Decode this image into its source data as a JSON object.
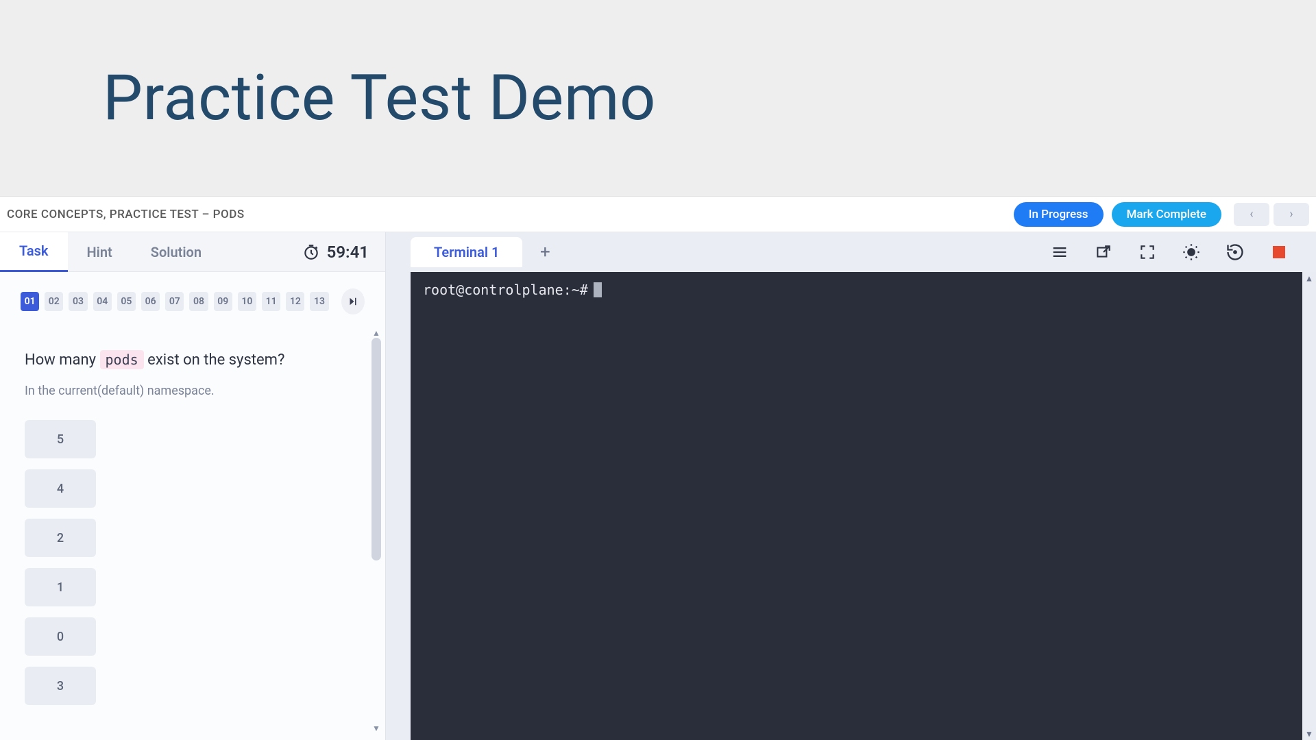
{
  "header": {
    "title": "Practice Test Demo"
  },
  "breadcrumb": "CORE CONCEPTS, PRACTICE TEST – PODS",
  "status": {
    "in_progress": "In Progress",
    "mark_complete": "Mark Complete"
  },
  "tabs": {
    "task": "Task",
    "hint": "Hint",
    "solution": "Solution",
    "active": "task"
  },
  "timer": "59:41",
  "steps": [
    "01",
    "02",
    "03",
    "04",
    "05",
    "06",
    "07",
    "08",
    "09",
    "10",
    "11",
    "12",
    "13"
  ],
  "active_step": "01",
  "question": {
    "pre": "How many ",
    "code": "pods",
    "post": " exist on the system?"
  },
  "subtext": "In the current(default) namespace.",
  "answers": [
    "5",
    "4",
    "2",
    "1",
    "0",
    "3"
  ],
  "terminal": {
    "tab_label": "Terminal 1",
    "prompt": "root@controlplane:~#"
  },
  "icons": {
    "menu": "menu",
    "popout": "popout",
    "fullscreen": "fullscreen",
    "theme": "theme",
    "restore": "restore",
    "stop": "stop",
    "prev": "‹",
    "next": "›",
    "plus": "+"
  }
}
